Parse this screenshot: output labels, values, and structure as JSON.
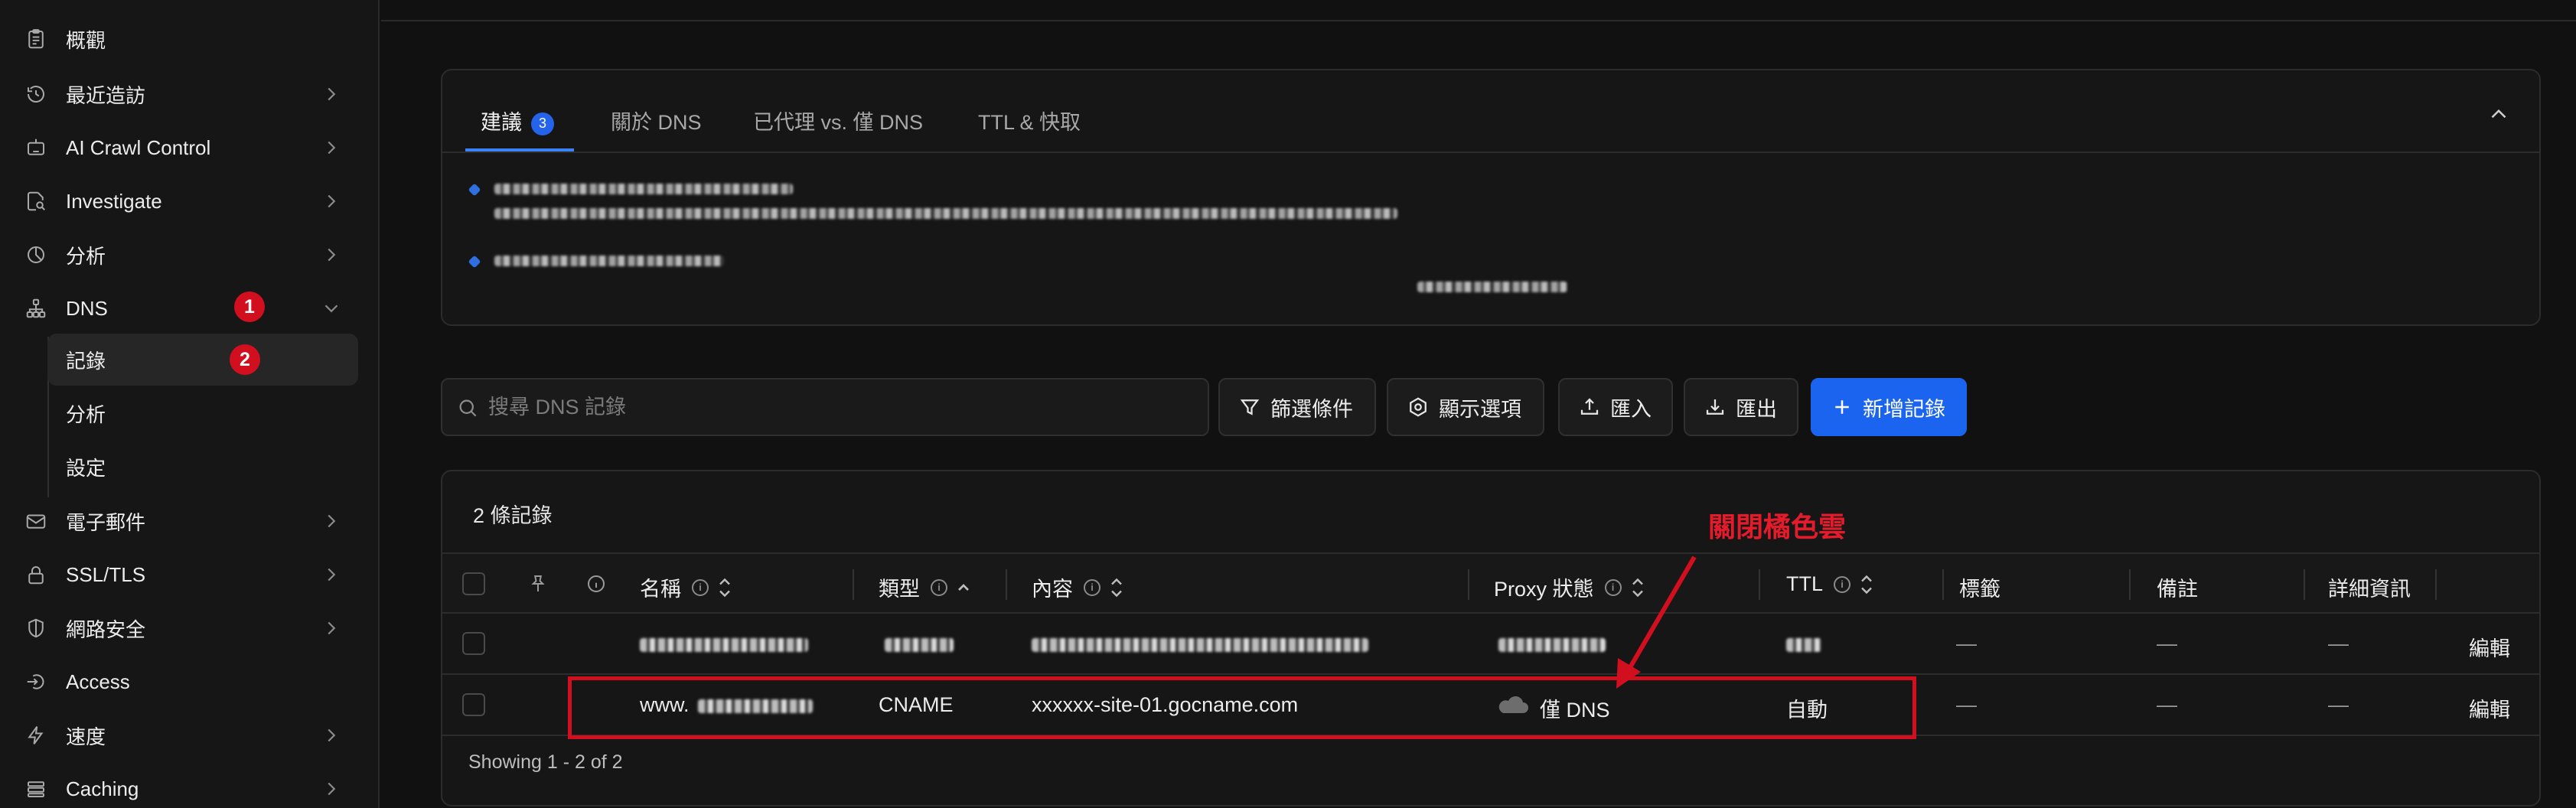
{
  "sidebar": {
    "items": [
      {
        "label": "概觀",
        "icon": "clipboard-icon"
      },
      {
        "label": "最近造訪",
        "icon": "clock-icon"
      },
      {
        "label": "AI Crawl Control",
        "icon": "robot-icon"
      },
      {
        "label": "Investigate",
        "icon": "document-search-icon"
      },
      {
        "label": "分析",
        "icon": "pie-chart-icon"
      },
      {
        "label": "DNS",
        "icon": "network-icon"
      },
      {
        "label": "電子郵件",
        "icon": "mail-icon"
      },
      {
        "label": "SSL/TLS",
        "icon": "lock-icon"
      },
      {
        "label": "網路安全",
        "icon": "shield-icon"
      },
      {
        "label": "Access",
        "icon": "access-icon"
      },
      {
        "label": "速度",
        "icon": "lightning-icon"
      },
      {
        "label": "Caching",
        "icon": "stack-icon"
      }
    ],
    "dns_sub": [
      "記錄",
      "分析",
      "設定"
    ],
    "badges": {
      "dns": "1",
      "records": "2"
    }
  },
  "tabs": {
    "items": [
      "建議",
      "關於 DNS",
      "已代理 vs. 僅 DNS",
      "TTL & 快取"
    ],
    "suggestion_count": "3"
  },
  "toolbar": {
    "search_placeholder": "搜尋 DNS 記錄",
    "filter": "篩選條件",
    "display": "顯示選項",
    "import": "匯入",
    "export": "匯出",
    "add": "新增記錄"
  },
  "table": {
    "count_label": "2 條記錄",
    "headers": {
      "name": "名稱",
      "type": "類型",
      "content": "內容",
      "proxy": "Proxy 狀態",
      "ttl": "TTL",
      "tags": "標籤",
      "notes": "備註",
      "details": "詳細資訊"
    },
    "rows": [
      {
        "name": "",
        "type": "",
        "content": "",
        "proxy": "",
        "ttl": "",
        "tags": "—",
        "notes": "—",
        "details": "—",
        "action": "編輯"
      },
      {
        "name": "www.",
        "type": "CNAME",
        "content": "xxxxxx-site-01.gocname.com",
        "proxy": "僅 DNS",
        "ttl": "自動",
        "tags": "—",
        "notes": "—",
        "details": "—",
        "action": "編輯"
      }
    ],
    "footer": "Showing 1 - 2 of 2"
  },
  "annotation": {
    "label": "關閉橘色雲",
    "color": "#d20f1f"
  },
  "colors": {
    "accent": "#1a64f0",
    "badge_red": "#d20f1f",
    "background": "#111111"
  }
}
